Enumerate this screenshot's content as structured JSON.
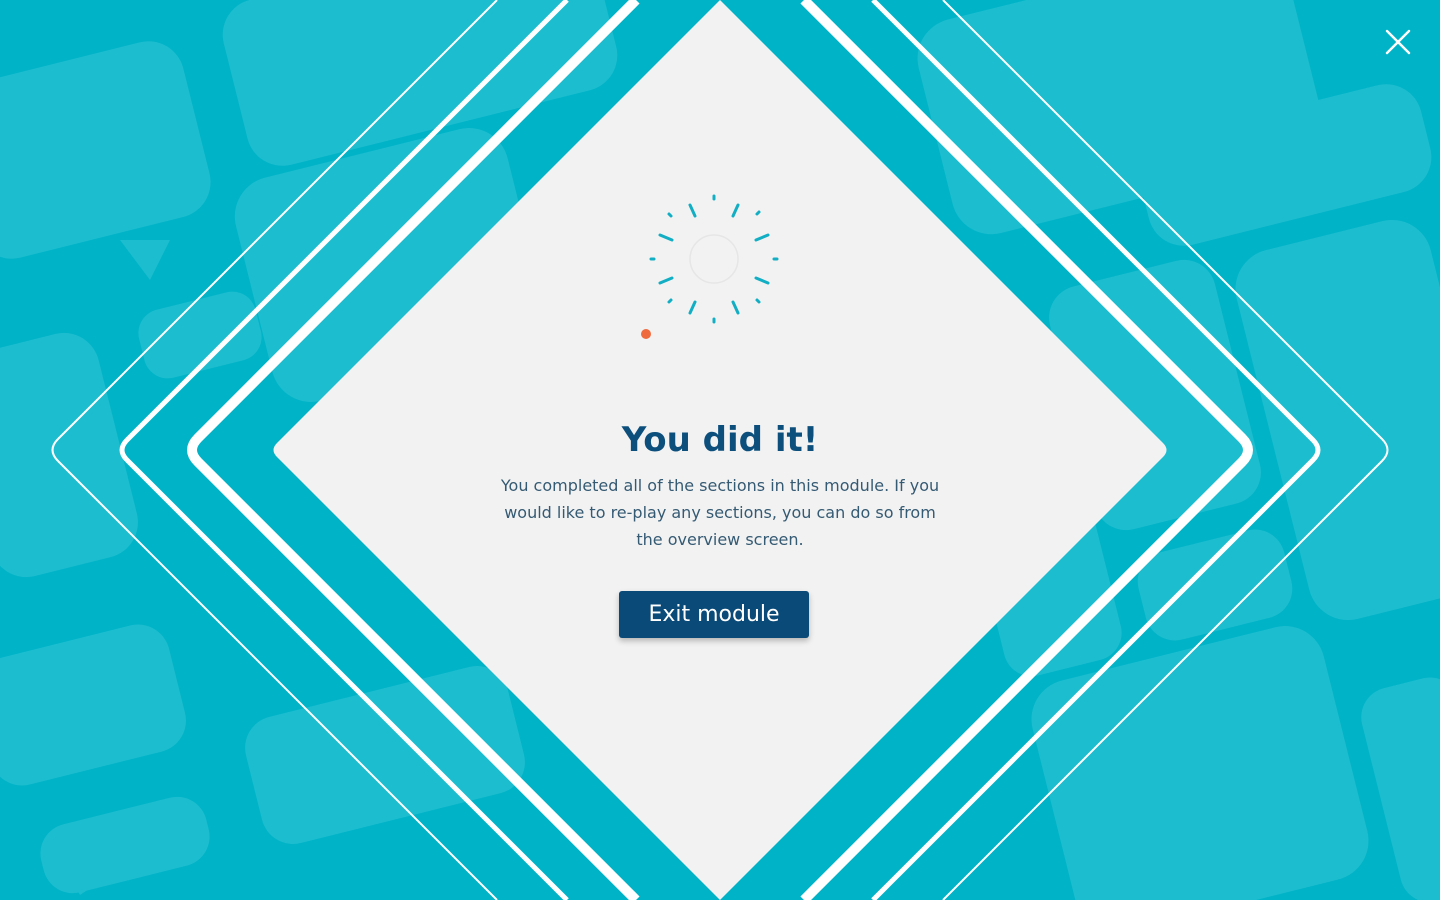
{
  "modal": {
    "title": "You did it!",
    "message": "You completed all of the sections in this module. If you would like to re-play any sections, you can do so from the overview screen.",
    "exit_button_label": "Exit module"
  },
  "icons": {
    "close": "close-icon",
    "burst": "sparkle-burst-icon",
    "dot": "orange-dot"
  },
  "colors": {
    "background": "#00b3c7",
    "bubble": "#1cbdcf",
    "card": "#f2f2f2",
    "title": "#0d4f7c",
    "text": "#355a73",
    "button": "#0a4a78",
    "burst": "#12aec3",
    "accent_dot": "#ef6a3d",
    "outline": "#ffffff"
  }
}
